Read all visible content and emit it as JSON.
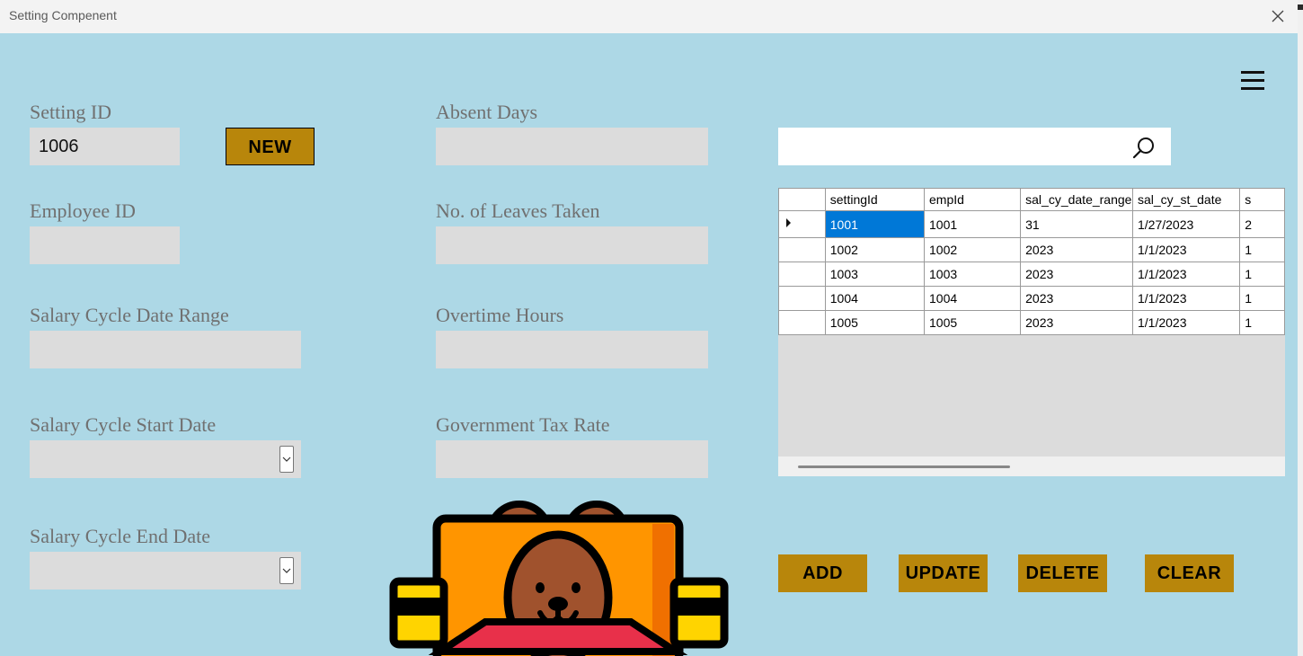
{
  "window": {
    "title": "Setting Compenent"
  },
  "form": {
    "setting_id": {
      "label": "Setting ID",
      "value": "1006"
    },
    "new_button": "NEW",
    "employee_id": {
      "label": "Employee ID",
      "value": ""
    },
    "salary_cycle_date_range": {
      "label": "Salary Cycle Date Range",
      "value": ""
    },
    "salary_cycle_start_date": {
      "label": "Salary Cycle Start Date",
      "value": ""
    },
    "salary_cycle_end_date": {
      "label": "Salary Cycle End Date",
      "value": ""
    },
    "absent_days": {
      "label": "Absent Days",
      "value": ""
    },
    "leaves_taken": {
      "label": "No. of Leaves Taken",
      "value": ""
    },
    "overtime_hours": {
      "label": "Overtime Hours",
      "value": ""
    },
    "government_tax_rate": {
      "label": "Government Tax Rate",
      "value": ""
    }
  },
  "search": {
    "value": "",
    "icon": "search-icon"
  },
  "grid": {
    "columns": [
      "settingId",
      "empId",
      "sal_cy_date_range",
      "sal_cy_st_date",
      "s"
    ],
    "rows": [
      [
        "1001",
        "1001",
        "31",
        "1/27/2023",
        "2"
      ],
      [
        "1002",
        "1002",
        "2023",
        "1/1/2023",
        "1"
      ],
      [
        "1003",
        "1003",
        "2023",
        "1/1/2023",
        "1"
      ],
      [
        "1004",
        "1004",
        "2023",
        "1/1/2023",
        "1"
      ],
      [
        "1005",
        "1005",
        "2023",
        "1/1/2023",
        "1"
      ]
    ],
    "selected_row": 0,
    "selection_color": "#0078d7"
  },
  "actions": {
    "add": "ADD",
    "update": "UPDATE",
    "delete": "DELETE",
    "clear": "CLEAR"
  },
  "colors": {
    "background": "#add8e6",
    "button": "#b8860b",
    "field": "#dcdcdc"
  },
  "icons": {
    "menu": "hamburger-menu-icon",
    "close": "close-icon",
    "illustration": "teddy-bear-in-box-icon"
  }
}
